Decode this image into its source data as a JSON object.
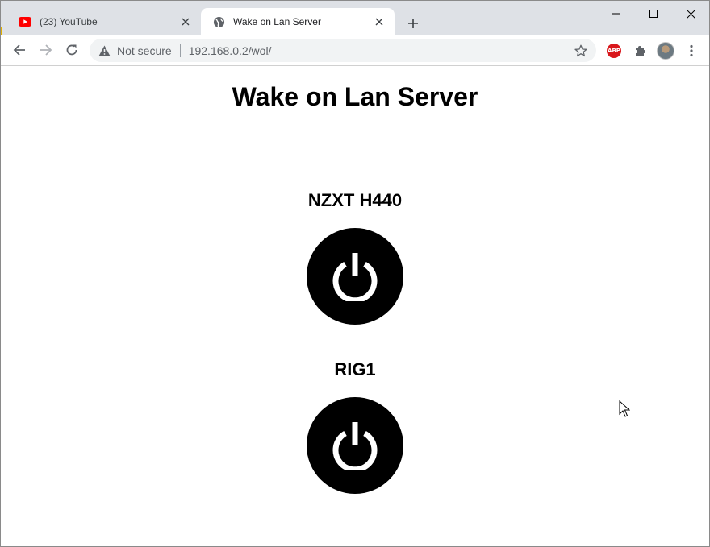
{
  "browser": {
    "tabs": [
      {
        "title": "(23) YouTube",
        "favicon": "youtube-icon",
        "active": false
      },
      {
        "title": "Wake on Lan Server",
        "favicon": "globe-icon",
        "active": true
      }
    ],
    "security_label": "Not secure",
    "url": "192.168.0.2/wol/",
    "extensions": [
      "adblock-plus-icon",
      "puzzle-icon",
      "avatar",
      "more-icon"
    ],
    "abp_label": "ABP"
  },
  "page": {
    "title": "Wake on Lan Server",
    "devices": [
      {
        "name": "NZXT H440",
        "button_icon": "power-icon"
      },
      {
        "name": "RIG1",
        "button_icon": "power-icon"
      }
    ]
  },
  "colors": {
    "tabstrip_bg": "#dee1e6",
    "omnibox_bg": "#f1f3f4",
    "youtube_red": "#ff0000",
    "abp_red": "#d9171c",
    "power_button": "#000000"
  }
}
